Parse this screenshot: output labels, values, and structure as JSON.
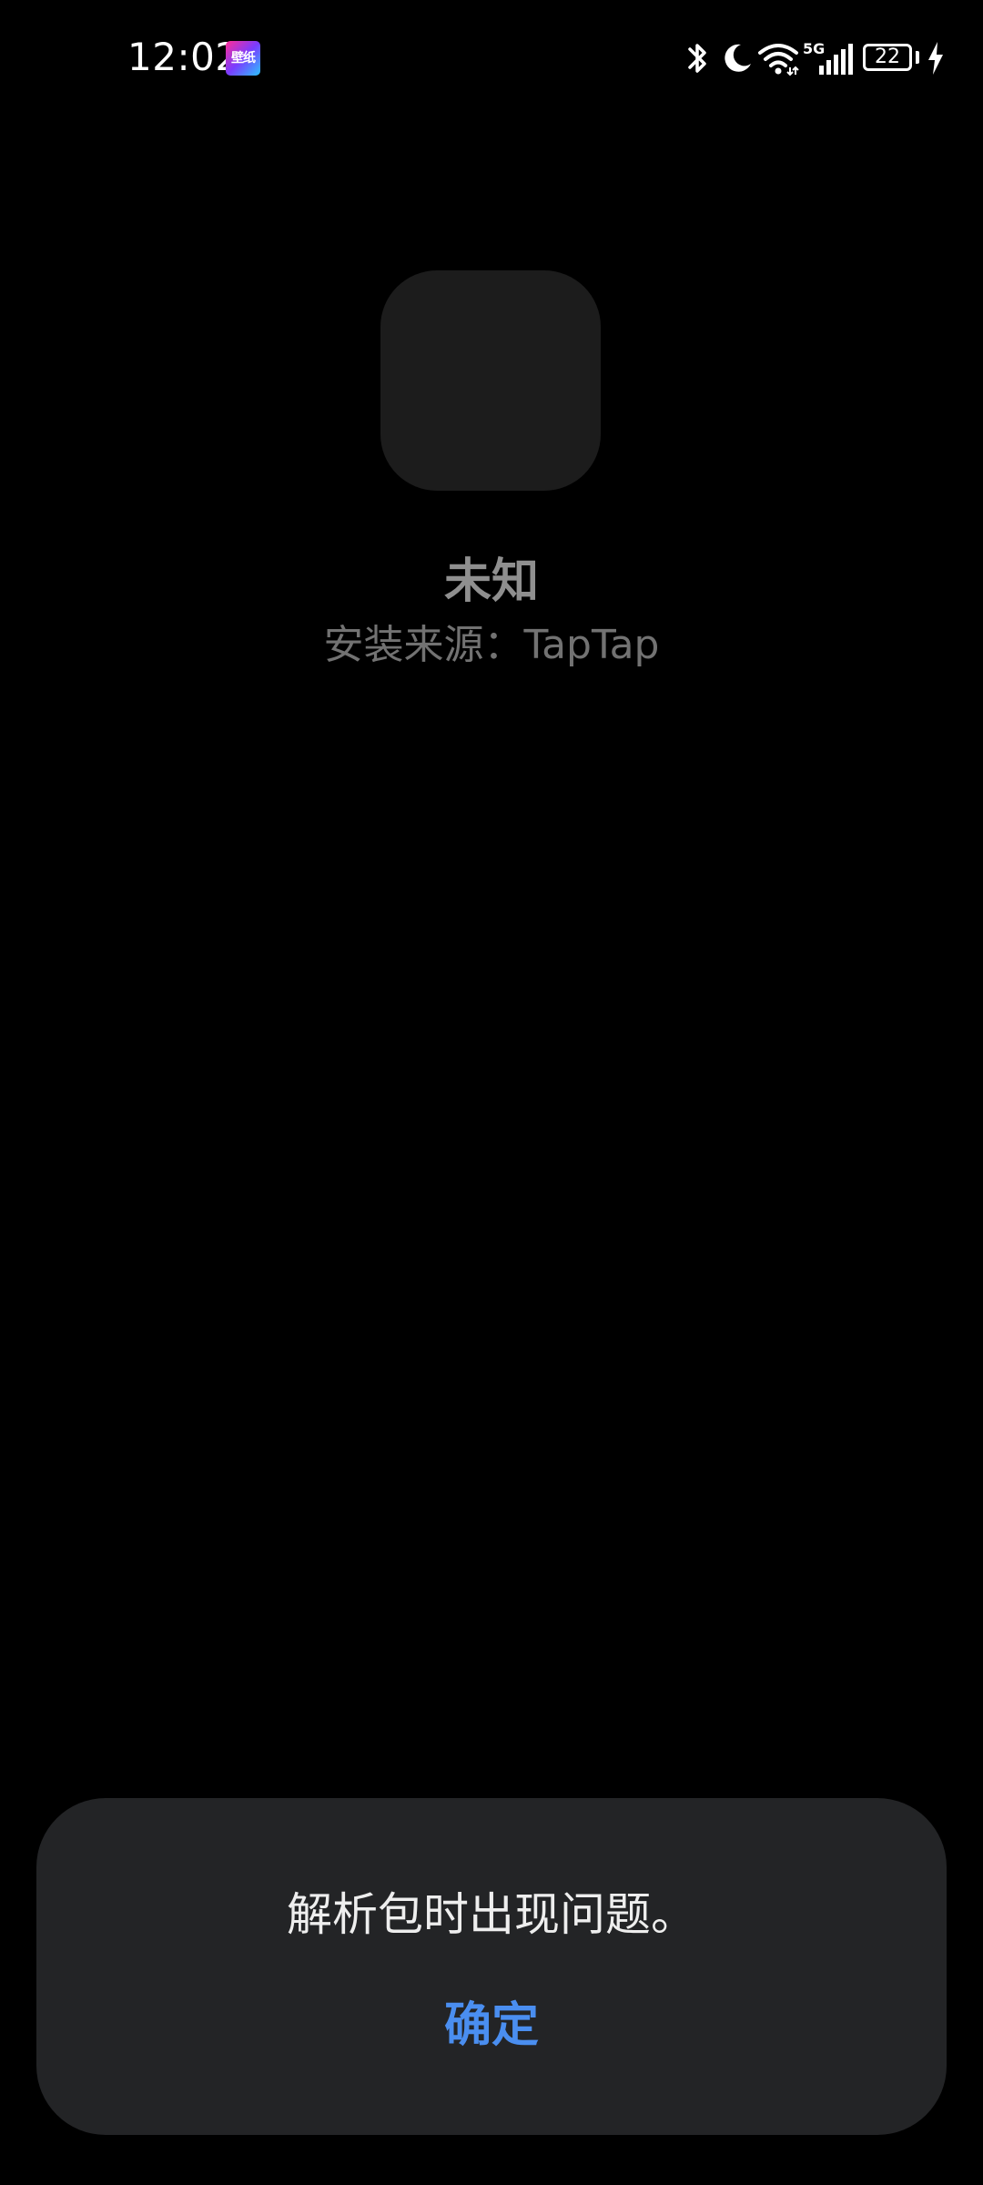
{
  "status_bar": {
    "time": "12:02",
    "wallpaper_badge": "壁纸",
    "network": "5G",
    "battery_level": "22",
    "icons": [
      "bluetooth-icon",
      "moon-icon",
      "wifi-icon",
      "signal-icon",
      "battery-icon",
      "charging-icon"
    ]
  },
  "app": {
    "name": "未知",
    "install_source": "安装来源：TapTap"
  },
  "dialog": {
    "message": "解析包时出现问题。",
    "confirm_label": "确定"
  },
  "colors": {
    "background": "#000000",
    "dialog_background": "#232426",
    "accent": "#4a8ef0",
    "icon_placeholder": "#1c1c1c"
  }
}
